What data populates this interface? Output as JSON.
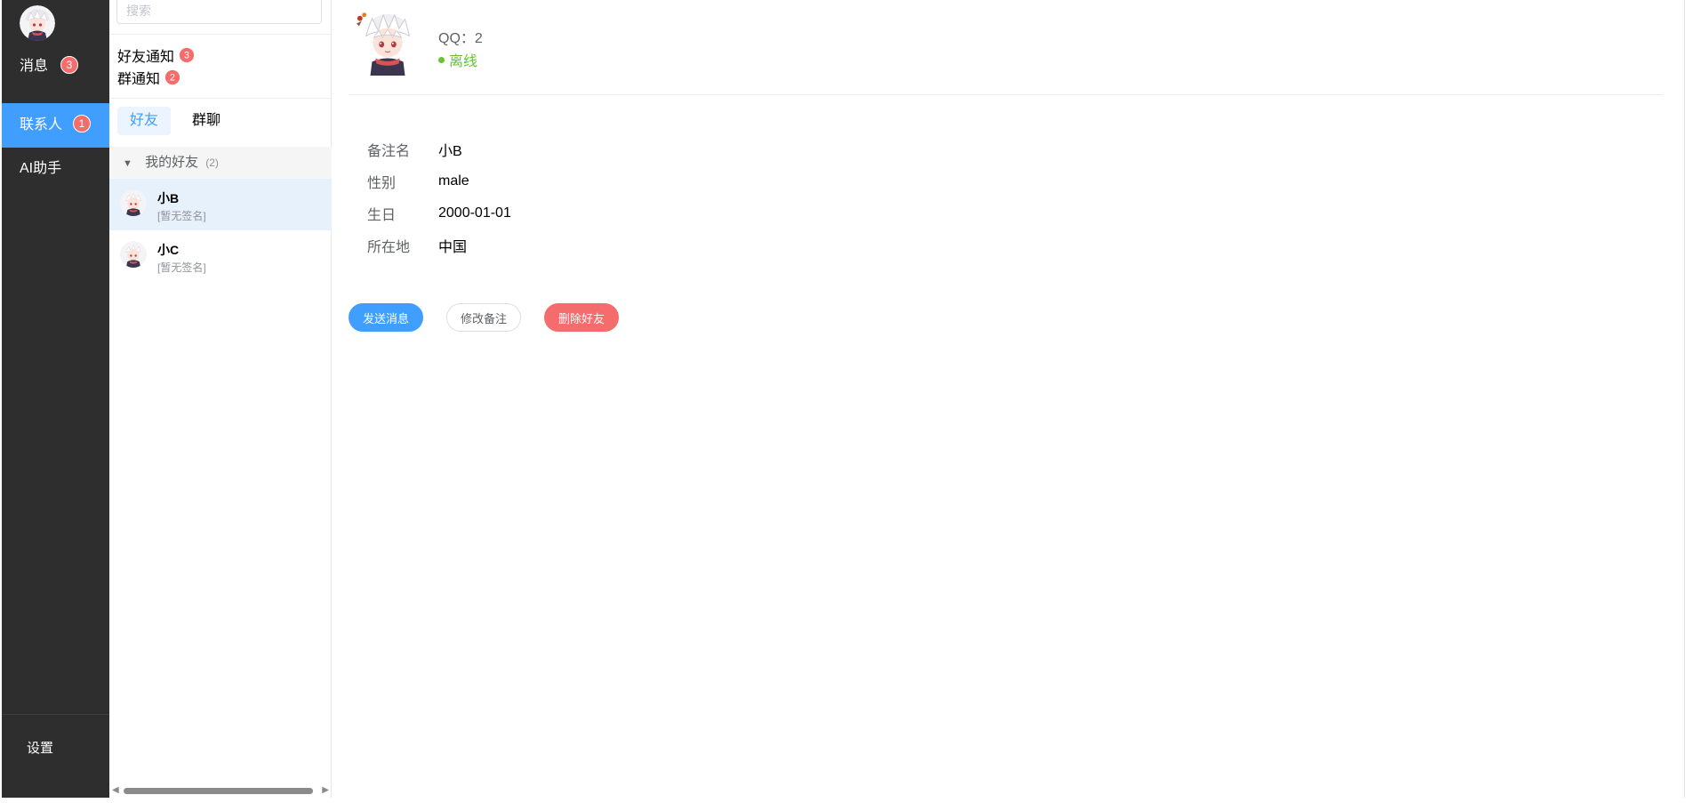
{
  "sidebar": {
    "nav": [
      {
        "label": "消息",
        "badge": "3"
      },
      {
        "label": "联系人",
        "badge": "1"
      },
      {
        "label": "AI助手"
      }
    ],
    "settings_label": "设置"
  },
  "contacts": {
    "search_placeholder": "搜索",
    "friend_notice": {
      "label": "好友通知",
      "badge": "3"
    },
    "group_notice": {
      "label": "群通知",
      "badge": "2"
    },
    "tabs": [
      "好友",
      "群聊"
    ],
    "group": {
      "name": "我的好友",
      "count": "(2)"
    },
    "friends": [
      {
        "name": "小B",
        "signature": "[暂无签名]"
      },
      {
        "name": "小C",
        "signature": "[暂无签名]"
      }
    ]
  },
  "detail": {
    "qq": "QQ：2",
    "status": "离线",
    "fields": [
      {
        "label": "备注名",
        "value": "小B"
      },
      {
        "label": "性别",
        "value": "male"
      },
      {
        "label": "生日",
        "value": "2000-01-01"
      },
      {
        "label": "所在地",
        "value": "中国"
      }
    ],
    "buttons": {
      "send": "发送消息",
      "edit_remark": "修改备注",
      "delete": "删除好友"
    }
  },
  "colors": {
    "accent": "#409eff",
    "danger": "#f56c6c",
    "online_status": "#67c23a",
    "sidebar_bg": "#2e2e2e"
  }
}
